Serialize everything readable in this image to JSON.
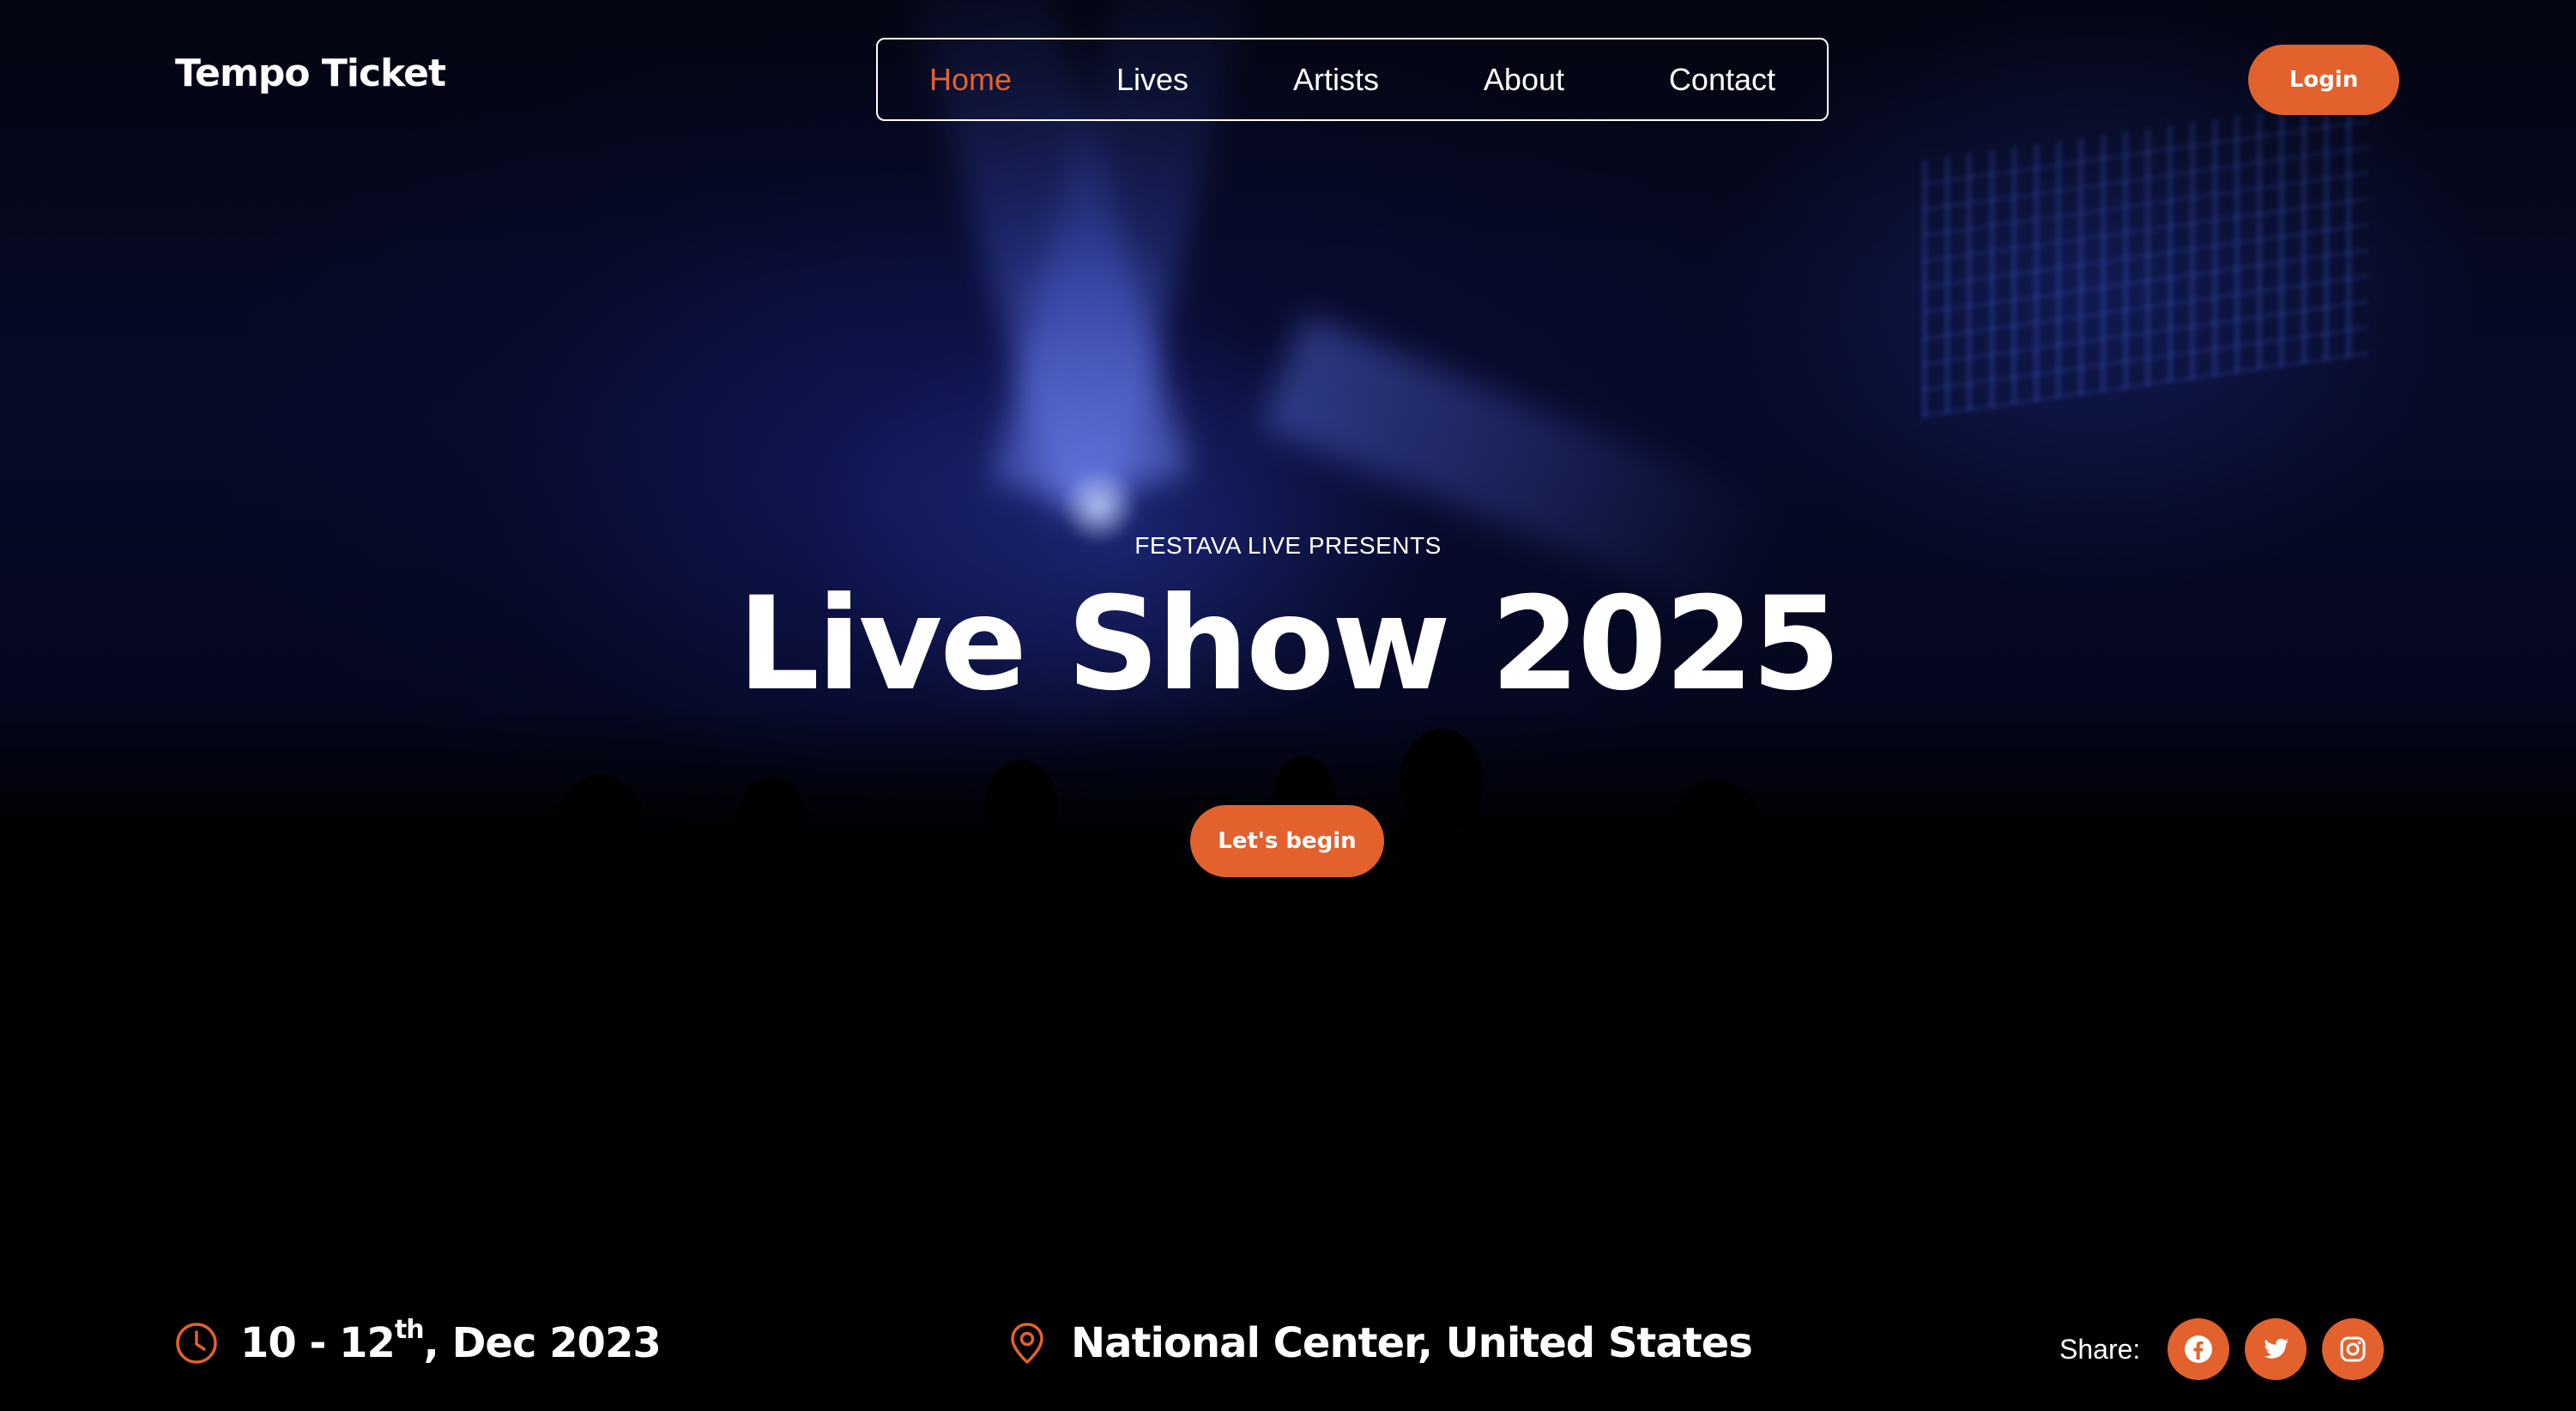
{
  "brand": {
    "name": "Tempo Ticket"
  },
  "nav": {
    "items": [
      {
        "label": "Home",
        "active": true
      },
      {
        "label": "Lives",
        "active": false
      },
      {
        "label": "Artists",
        "active": false
      },
      {
        "label": "About",
        "active": false
      },
      {
        "label": "Contact",
        "active": false
      }
    ]
  },
  "header": {
    "login_label": "Login"
  },
  "hero": {
    "eyebrow": "FESTAVA LIVE PRESENTS",
    "title": "Live Show 2025",
    "cta_label": "Let's begin"
  },
  "event": {
    "date_range": "10 - 12",
    "date_suffix": "th",
    "date_rest": ", Dec 2023",
    "venue": "National Center, United States"
  },
  "share": {
    "label": "Share:",
    "networks": [
      "facebook-icon",
      "twitter-icon",
      "instagram-icon"
    ]
  },
  "colors": {
    "accent": "#e2612d",
    "text": "#ffffff",
    "background": "#020206"
  }
}
